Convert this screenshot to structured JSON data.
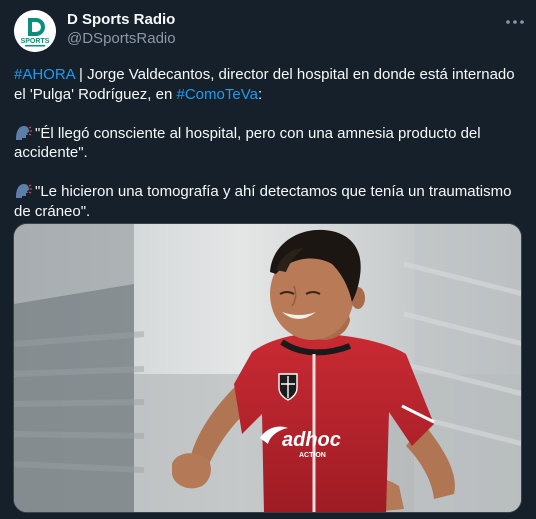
{
  "account": {
    "name": "D Sports Radio",
    "handle": "@DSportsRadio",
    "avatar_text": "SPORTS",
    "avatar_letter": "D"
  },
  "tweet": {
    "line1_tag": "#AHORA",
    "line1_text": " | Jorge Valdecantos, director del hospital en donde está internado el 'Pulga' Rodríguez, en ",
    "line1_tag2": "#ComoTeVa",
    "line1_end": ":",
    "quote1": "\"Él llegó consciente al hospital, pero con una amnesia producto del accidente\".",
    "quote2": "\"Le hicieron una tomografía y ahí detectamos que tenía un traumatismo de cráneo\".",
    "quote_icon": "speaking-head-icon"
  },
  "media": {
    "description_icon": "photo",
    "sponsor_text": "adhoc",
    "sponsor_sub": "ACTION"
  },
  "colors": {
    "background": "#15202b",
    "link": "#1d9bf0",
    "muted": "#8b98a5",
    "jersey": "#c8242d"
  }
}
